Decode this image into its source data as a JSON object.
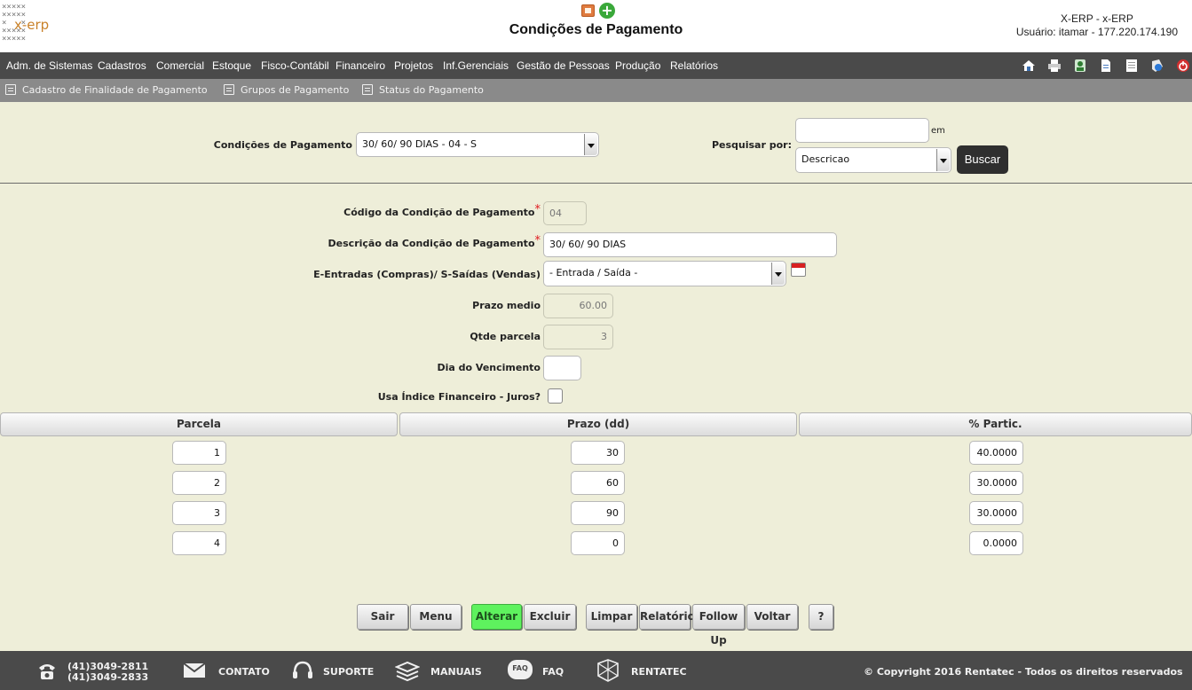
{
  "header": {
    "logo_text": "x-erp",
    "title": "Condições de Pagamento",
    "user_line1": "X-ERP - x-ERP",
    "user_line2": "Usuário: itamar - 177.220.174.190"
  },
  "menu": {
    "items": [
      "Adm. de Sistemas",
      "Cadastros",
      "Comercial",
      "Estoque",
      "Fisco-Contábil",
      "Financeiro",
      "Projetos",
      "Inf.Gerenciais",
      "Gestão de Pessoas",
      "Produção",
      "Relatórios"
    ],
    "toolbar_icons": [
      "home-icon",
      "print-icon",
      "users-icon",
      "document-icon",
      "notes-icon",
      "help-icon",
      "power-icon"
    ]
  },
  "submenu": {
    "items": [
      "Cadastro de Finalidade de Pagamento",
      "Grupos de Pagamento",
      "Status do Pagamento"
    ]
  },
  "search": {
    "condicoes_label": "Condições de Pagamento",
    "condicoes_value": "30/ 60/ 90 DIAS - 04 - S",
    "pesquisar_label": "Pesquisar por:",
    "pesquisar_value": "",
    "em_label": "em",
    "field_value": "Descricao",
    "buscar_label": "Buscar"
  },
  "form": {
    "codigo_label": "Código da Condição de Pagamento",
    "codigo_value": "04",
    "descricao_label": "Descrição da Condição de Pagamento",
    "descricao_value": "30/ 60/ 90 DIAS",
    "tipo_label": "E-Entradas (Compras)/ S-Saídas (Vendas)",
    "tipo_value": "- Entrada / Saída -",
    "prazo_medio_label": "Prazo medio",
    "prazo_medio_value": "60.00",
    "qtde_parcela_label": "Qtde parcela",
    "qtde_parcela_value": "3",
    "dia_venc_label": "Dia do Vencimento",
    "dia_venc_value": "",
    "usa_indice_label": "Usa Índice Financeiro - Juros?",
    "required_mark": "*"
  },
  "grid": {
    "headers": [
      "Parcela",
      "Prazo (dd)",
      "% Partic."
    ],
    "rows": [
      {
        "parcela": "1",
        "prazo": "30",
        "partic": "40.0000"
      },
      {
        "parcela": "2",
        "prazo": "60",
        "partic": "30.0000"
      },
      {
        "parcela": "3",
        "prazo": "90",
        "partic": "30.0000"
      },
      {
        "parcela": "4",
        "prazo": "0",
        "partic": "0.0000"
      }
    ]
  },
  "actions": {
    "sair": "Sair",
    "menu": "Menu",
    "alterar": "Alterar",
    "excluir": "Excluir",
    "limpar": "Limpar",
    "relatorio": "Relatório",
    "follow_up": "Follow Up",
    "voltar": "Voltar",
    "help": "?"
  },
  "footer": {
    "phone1": "(41)3049-2811",
    "phone2": "(41)3049-2833",
    "contato": "CONTATO",
    "suporte": "SUPORTE",
    "manuais": "MANUAIS",
    "faq": "FAQ",
    "faq_icon_text": "FAQ",
    "rentatec": "RENTATEC",
    "copyright": "© Copyright 2016 Rentatec - Todos os direitos reservados"
  },
  "colors": {
    "page_bg": "#eeeed9",
    "menubar": "#4a4a4a",
    "submenubar": "#8a8a8a",
    "alterar_green": "#5ef25e",
    "logo_orange": "#c9822a"
  }
}
